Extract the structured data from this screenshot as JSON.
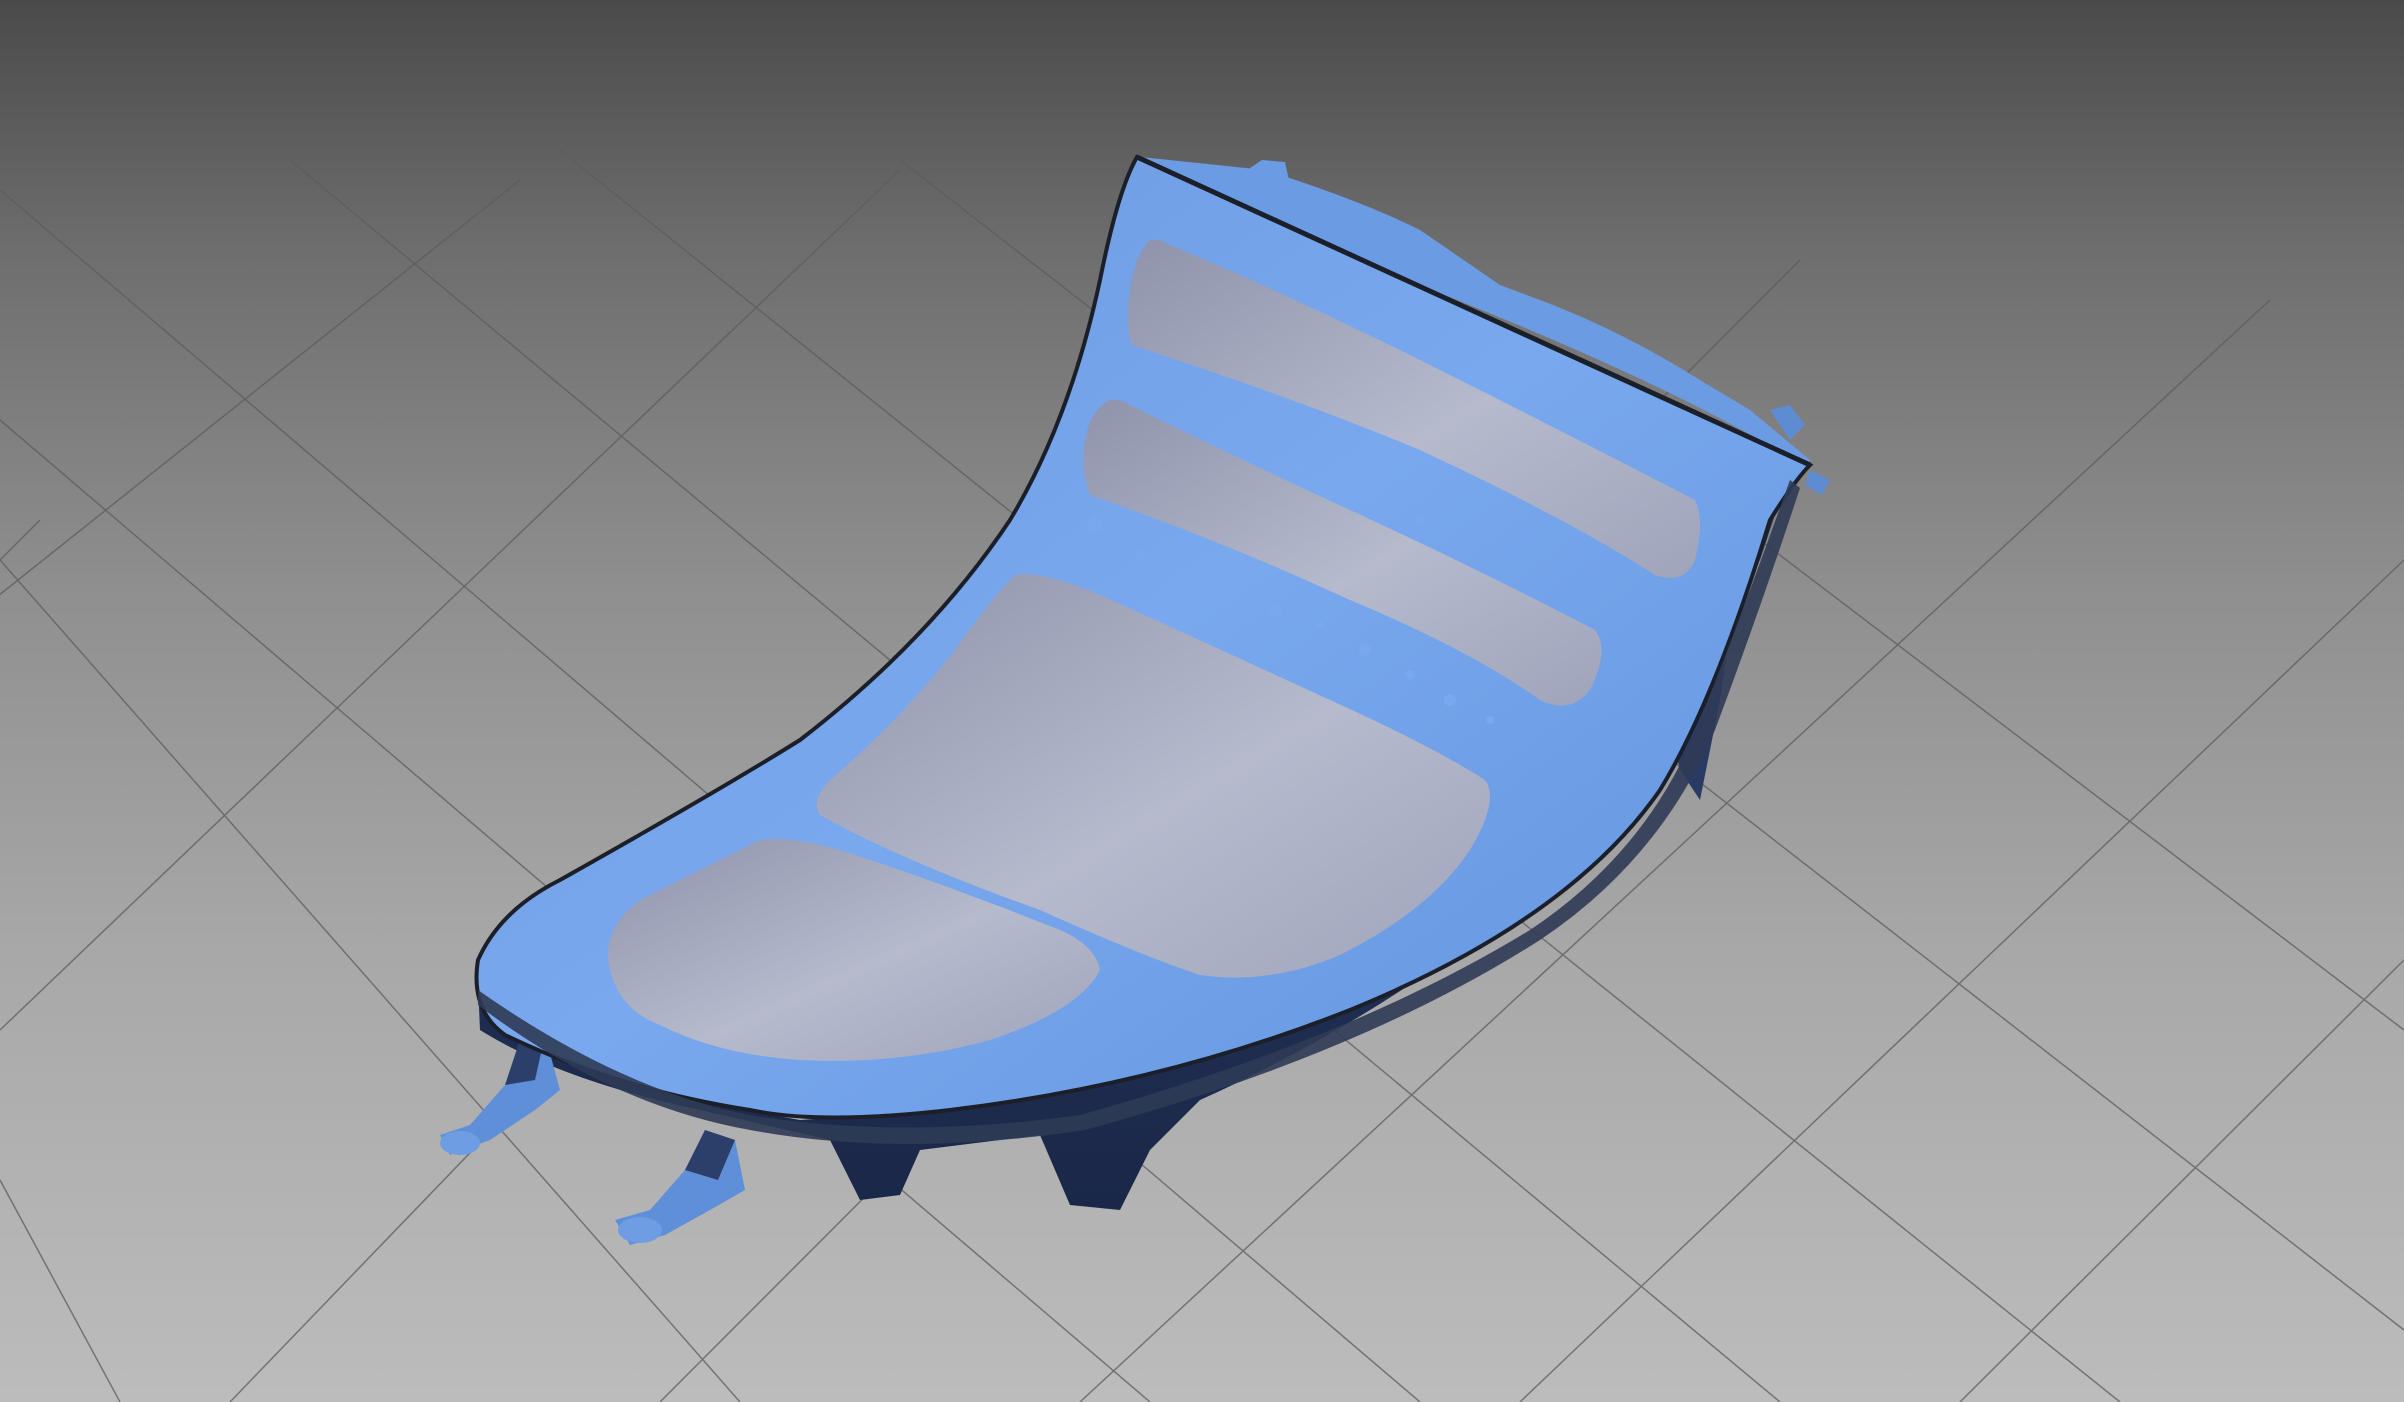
{
  "viewport": {
    "background_top": "#4a4a4a",
    "background_bottom": "#bcbcbc",
    "grid_color": "#5c5c5c",
    "view_mode": "3d-perspective"
  },
  "model": {
    "type": "3D scan mesh (center console trim panel)",
    "mesh_color": "#6f9fe6",
    "mesh_shadow_color": "#22335a",
    "cad_surface_color": "#a8aec6",
    "edge_color": "#1b1f2a"
  }
}
